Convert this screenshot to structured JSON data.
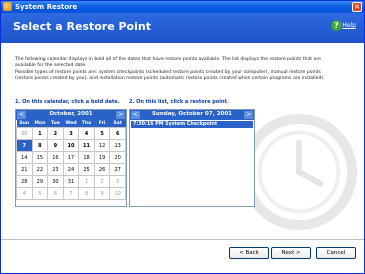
{
  "window": {
    "title": "System Restore"
  },
  "header": {
    "title": "Select a Restore Point",
    "help_label": "Help",
    "help_icon": "help-icon"
  },
  "intro": {
    "paragraph1": "The following calendar displays in bold all of the dates that have restore points available. The list displays the restore points that are available for the selected date.",
    "paragraph2": "Possible types of restore points are: system checkpoints (scheduled restore points created by your computer), manual restore points (restore points created by you), and installation restore points (automatic restore points created when certain programs are installed)."
  },
  "steps": {
    "step1": "1. On this calendar, click a bold date.",
    "step2": "2. On this list, click a restore point."
  },
  "calendar": {
    "month_label": "October, 2001",
    "prev": "<",
    "next": ">",
    "weekdays": [
      "Sun",
      "Mon",
      "Tue",
      "Wed",
      "Thu",
      "Fri",
      "Sat"
    ],
    "weeks": [
      [
        "30",
        "1",
        "2",
        "3",
        "4",
        "5",
        "6"
      ],
      [
        "7",
        "8",
        "9",
        "10",
        "11",
        "12",
        "13"
      ],
      [
        "14",
        "15",
        "16",
        "17",
        "18",
        "19",
        "20"
      ],
      [
        "21",
        "22",
        "23",
        "24",
        "25",
        "26",
        "27"
      ],
      [
        "28",
        "29",
        "30",
        "31",
        "1",
        "2",
        "3"
      ],
      [
        "4",
        "5",
        "6",
        "7",
        "8",
        "9",
        "10"
      ]
    ],
    "selected": "7",
    "bold_dates": [
      "1",
      "2",
      "3",
      "4",
      "5",
      "6",
      "7",
      "8",
      "9",
      "10",
      "11"
    ]
  },
  "restore_points": {
    "date_label": "Sunday, October 07, 2001",
    "prev": "<",
    "next": ">",
    "items": [
      {
        "label": "7:30:16 PM System Checkpoint"
      }
    ]
  },
  "buttons": {
    "back": "< Back",
    "next": "Next >",
    "cancel": "Cancel"
  }
}
